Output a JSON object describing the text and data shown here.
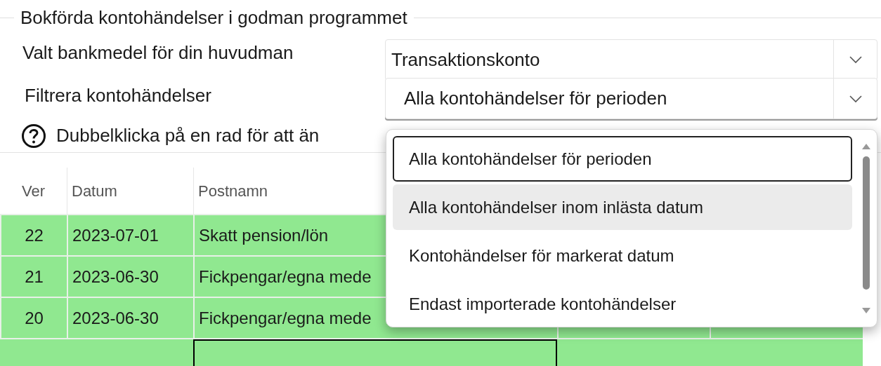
{
  "group_title": "Bokförda kontohändelser i godman programmet",
  "fields": [
    {
      "label": "Valt bankmedel för din huvudman",
      "value": "Transaktionskonto"
    },
    {
      "label": "Filtrera kontohändelser",
      "value": "Alla kontohändelser för perioden",
      "expanded": true
    }
  ],
  "help_text": "Dubbelklicka på en rad för att än",
  "table": {
    "columns": [
      "Ver",
      "Datum",
      "Postnamn"
    ],
    "rows": [
      {
        "ver": "22",
        "datum": "2023-07-01",
        "postnamn": "Skatt pension/lön"
      },
      {
        "ver": "21",
        "datum": "2023-06-30",
        "postnamn": "Fickpengar/egna mede"
      },
      {
        "ver": "20",
        "datum": "2023-06-30",
        "postnamn": "Fickpengar/egna mede"
      }
    ],
    "cut_row": {
      "focused": true
    }
  },
  "dropdown": {
    "options": [
      {
        "label": "Alla kontohändelser för perioden",
        "selected": true,
        "hovered": false
      },
      {
        "label": "Alla kontohändelser inom inlästa datum",
        "selected": false,
        "hovered": true
      },
      {
        "label": "Kontohändelser för markerat datum",
        "selected": false,
        "hovered": false
      },
      {
        "label": "Endast importerade kontohändelser",
        "selected": false,
        "hovered": false
      }
    ]
  }
}
